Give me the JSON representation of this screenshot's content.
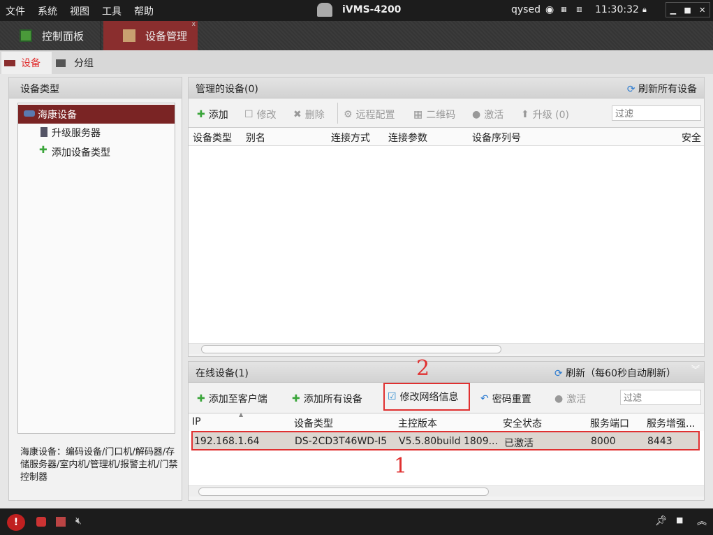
{
  "titlebar": {
    "menus": [
      "文件",
      "系统",
      "视图",
      "工具",
      "帮助"
    ],
    "app_title": "iVMS-4200",
    "user": "qysed",
    "time": "11:30:32"
  },
  "main_tabs": [
    {
      "label": "控制面板",
      "active": false
    },
    {
      "label": "设备管理",
      "active": true
    }
  ],
  "sub_tabs": [
    {
      "label": "设备",
      "active": true
    },
    {
      "label": "分组",
      "active": false
    }
  ],
  "left": {
    "header": "设备类型",
    "items": [
      {
        "label": "海康设备",
        "selected": true
      },
      {
        "label": "升级服务器"
      },
      {
        "label": "添加设备类型"
      }
    ],
    "description": "海康设备：编码设备/门口机/解码器/存储服务器/室内机/管理机/报警主机/门禁控制器"
  },
  "managed": {
    "title": "管理的设备(0)",
    "refresh_all": "刷新所有设备",
    "toolbar": [
      "添加",
      "修改",
      "删除",
      "远程配置",
      "二维码",
      "激活",
      "升级 (0)"
    ],
    "filter_placeholder": "过滤",
    "columns": [
      "设备类型",
      "别名",
      "连接方式",
      "连接参数",
      "设备序列号",
      "安全"
    ]
  },
  "online": {
    "title": "在线设备(1)",
    "refresh": "刷新（每60秒自动刷新）",
    "toolbar": [
      "添加至客户端",
      "添加所有设备",
      "修改网络信息",
      "密码重置",
      "激活"
    ],
    "filter_placeholder": "过滤",
    "columns": [
      "IP",
      "设备类型",
      "主控版本",
      "安全状态",
      "服务端口",
      "服务增强..."
    ],
    "rows": [
      [
        "192.168.1.64",
        "DS-2CD3T46WD-I5",
        "V5.5.80build 1809...",
        "已激活",
        "8000",
        "8443"
      ]
    ]
  },
  "annotations": {
    "label1": "1",
    "label2": "2",
    "color": "#e03030"
  }
}
